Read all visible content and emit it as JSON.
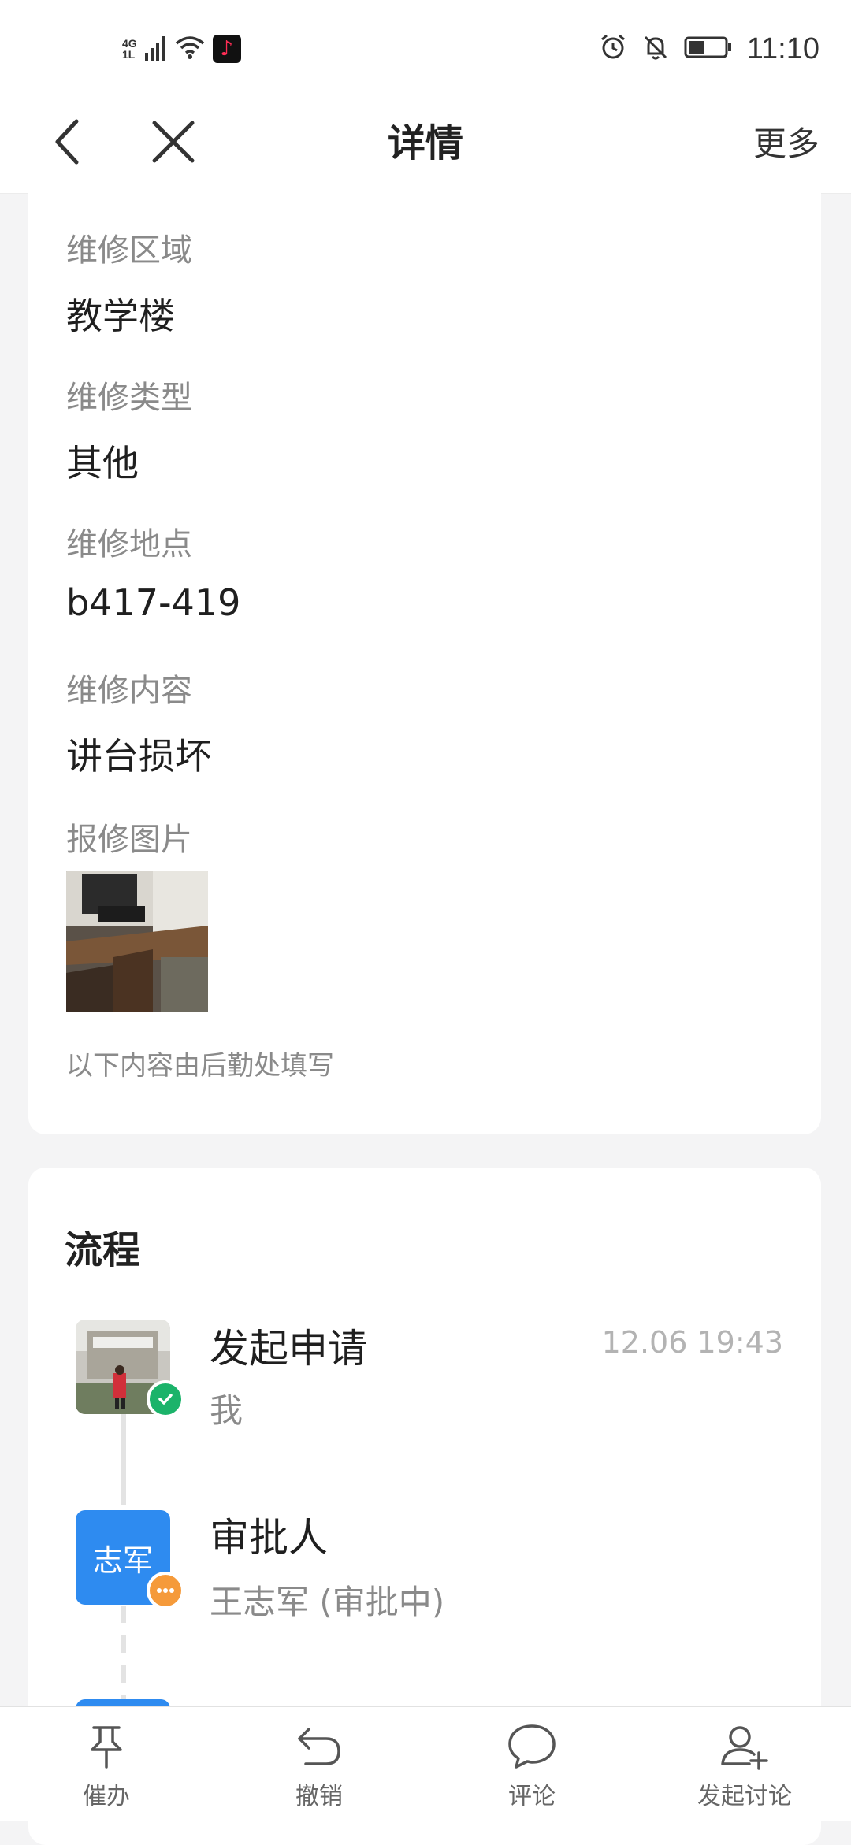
{
  "status_bar": {
    "network_top": "4G",
    "network_bottom": "1L",
    "app_icon": "tiktok-icon",
    "time": "11:10"
  },
  "nav": {
    "title": "详情",
    "more_label": "更多"
  },
  "details": {
    "fields": [
      {
        "label": "维修区域",
        "value": "教学楼"
      },
      {
        "label": "维修类型",
        "value": "其他"
      },
      {
        "label": "维修地点",
        "value": "b417-419"
      },
      {
        "label": "维修内容",
        "value": "讲台损坏"
      }
    ],
    "photo_label": "报修图片",
    "footnote": "以下内容由后勤处填写"
  },
  "process": {
    "title": "流程",
    "steps": [
      {
        "title": "发起申请",
        "subtitle": "我",
        "time": "12.06 19:43",
        "status": "done"
      },
      {
        "title": "审批人",
        "subtitle": "王志军 (审批中)",
        "avatar_text": "志军",
        "status": "pending"
      }
    ]
  },
  "bottom_bar": {
    "tabs": [
      {
        "label": "催办",
        "icon": "pin-icon"
      },
      {
        "label": "撤销",
        "icon": "undo-icon"
      },
      {
        "label": "评论",
        "icon": "comment-icon"
      },
      {
        "label": "发起讨论",
        "icon": "add-user-icon"
      }
    ]
  },
  "colors": {
    "accent_blue": "#2e8bf0",
    "success_green": "#1bb36a",
    "pending_orange": "#f59a3a"
  }
}
